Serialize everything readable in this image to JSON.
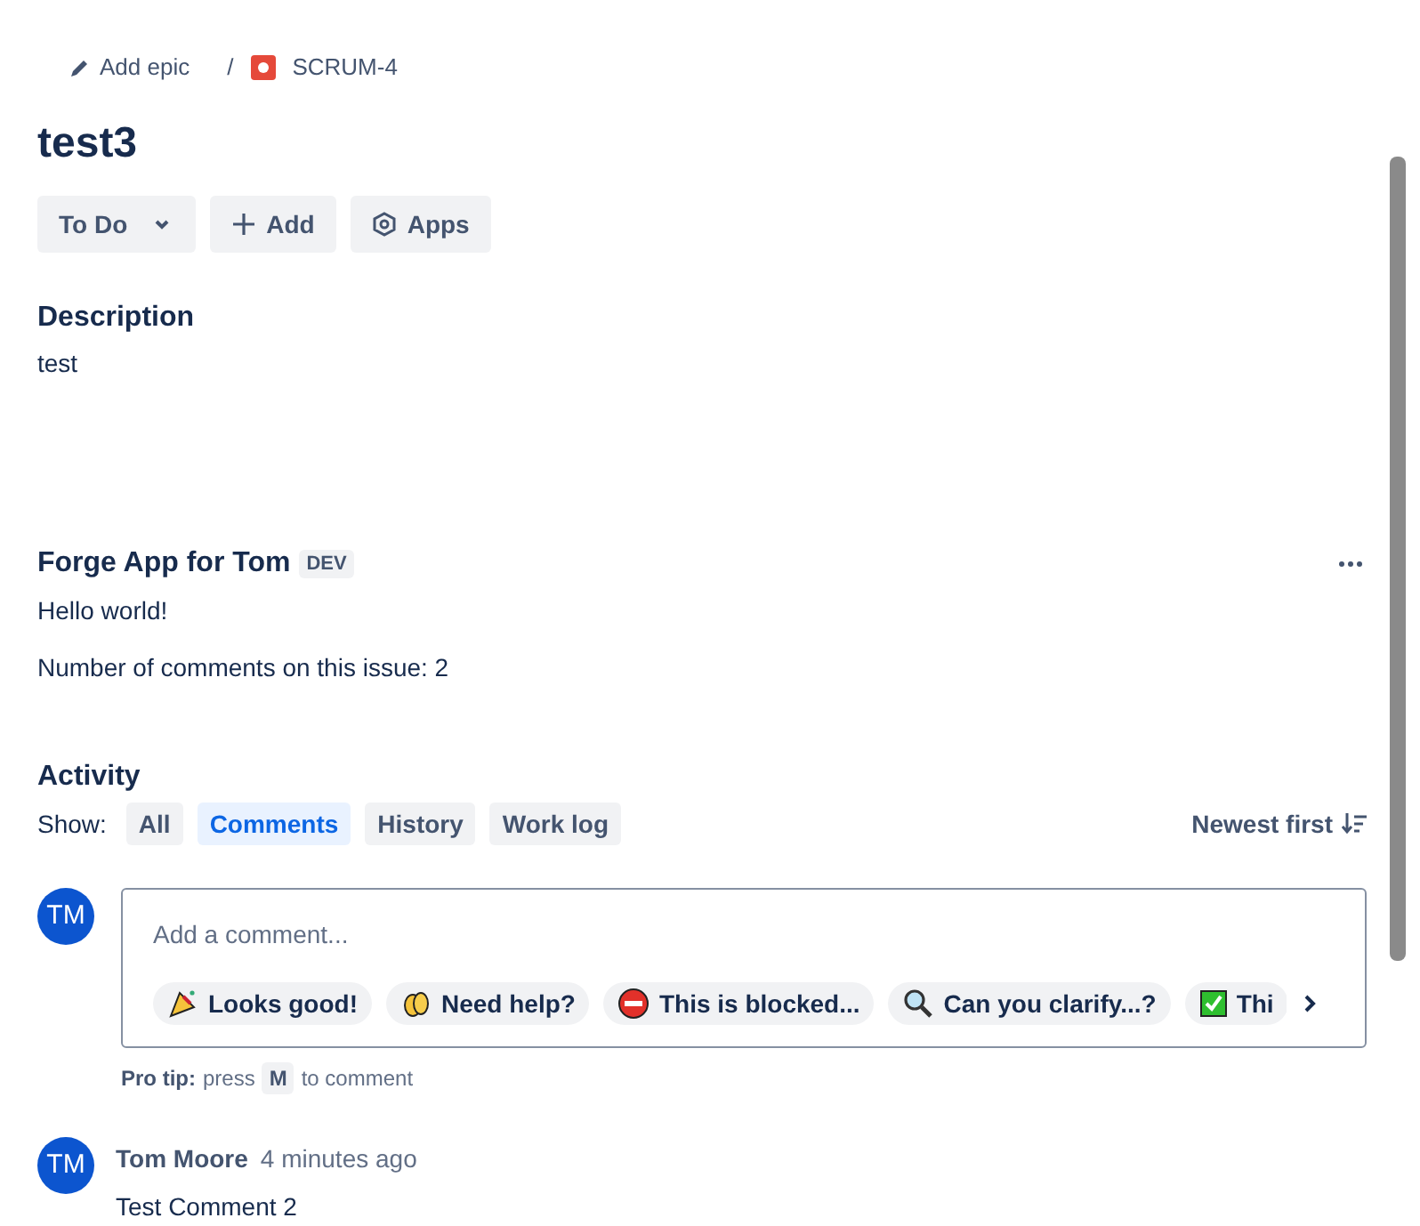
{
  "breadcrumb": {
    "add_epic": "Add epic",
    "separator": "/",
    "issue_key": "SCRUM-4"
  },
  "title": "test3",
  "actions": [
    {
      "label": "To Do",
      "kind": "status"
    },
    {
      "label": "Add",
      "kind": "add"
    },
    {
      "label": "Apps",
      "kind": "apps"
    }
  ],
  "description": {
    "heading": "Description",
    "body": "test"
  },
  "forge_panel": {
    "title": "Forge App for Tom",
    "badge": "DEV",
    "lines": [
      "Hello world!",
      "Number of comments on this issue: 2"
    ]
  },
  "activity": {
    "heading": "Activity",
    "show_label": "Show:",
    "filters": [
      {
        "label": "All",
        "selected": false
      },
      {
        "label": "Comments",
        "selected": true
      },
      {
        "label": "History",
        "selected": false
      },
      {
        "label": "Work log",
        "selected": false
      }
    ],
    "sort": "Newest first"
  },
  "composer": {
    "avatar": "TM",
    "placeholder": "Add a comment...",
    "quick_replies": [
      "Looks good!",
      "Need help?",
      "This is blocked...",
      "Can you clarify...?",
      "Thi"
    ],
    "tip_bold": "Pro tip:",
    "tip_before": "press",
    "tip_key": "M",
    "tip_after": "to comment"
  },
  "comments": [
    {
      "avatar": "TM",
      "author": "Tom Moore",
      "time": "4 minutes ago",
      "body": "Test Comment 2"
    }
  ]
}
